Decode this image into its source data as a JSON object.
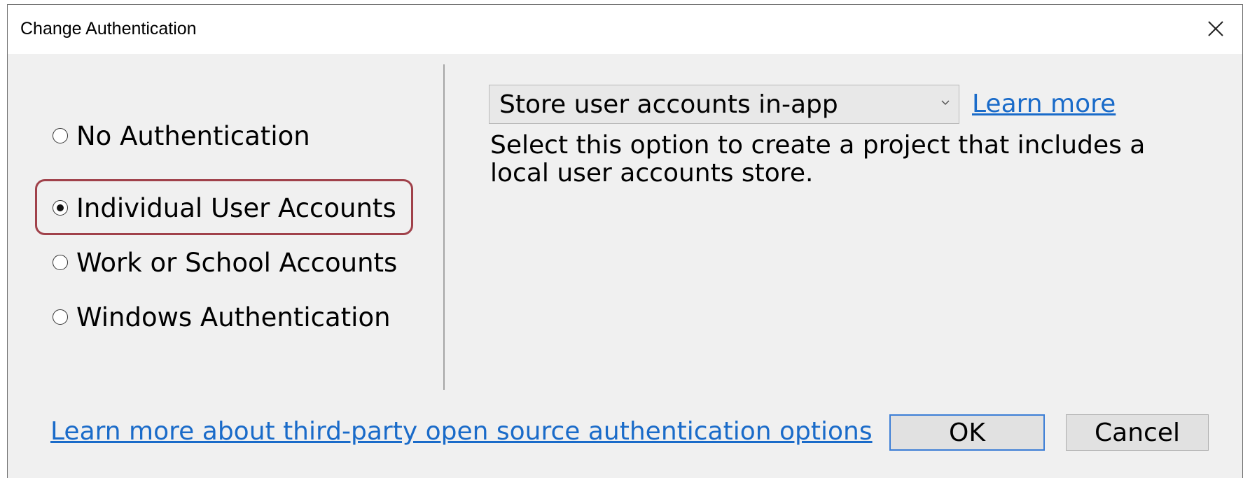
{
  "window": {
    "title": "Change Authentication",
    "close_icon": "close-icon"
  },
  "auth_options": [
    {
      "label": "No Authentication",
      "selected": false
    },
    {
      "label": "Individual User Accounts",
      "selected": true
    },
    {
      "label": "Work or School Accounts",
      "selected": false
    },
    {
      "label": "Windows Authentication",
      "selected": false
    }
  ],
  "store": {
    "selected_value": "Store user accounts in-app",
    "chevron_icon": "chevron-down-icon",
    "learn_more": "Learn more",
    "description": "Select this option to create a project that includes a local user accounts store."
  },
  "footer": {
    "link_text": "Learn more about third-party open source authentication options",
    "ok_label": "OK",
    "cancel_label": "Cancel"
  },
  "colors": {
    "link": "#1a6bc9",
    "highlight": "#a0414a",
    "dialog_bg": "#f0f0f0"
  }
}
